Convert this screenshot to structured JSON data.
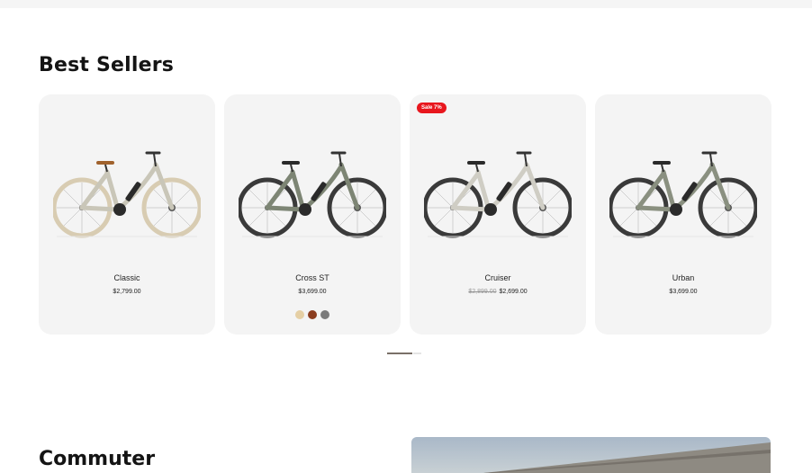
{
  "section": {
    "title": "Best Sellers"
  },
  "products": [
    {
      "name": "Classic",
      "price": "$2,799.00"
    },
    {
      "name": "Cross ST",
      "price": "$3,699.00",
      "swatches": [
        "#e5cfa4",
        "#8b3d1f",
        "#7b7b7b"
      ]
    },
    {
      "name": "Cruiser",
      "old_price": "$2,899.00",
      "price": "$2,699.00",
      "badge": "Sale 7%"
    },
    {
      "name": "Urban",
      "price": "$3,699.00"
    }
  ],
  "carousel": {
    "pages": 2,
    "active_page": 1
  },
  "next_section": {
    "title": "Commuter"
  },
  "colors": {
    "sale_badge": "#e8161d",
    "card_bg": "#f4f4f4"
  }
}
